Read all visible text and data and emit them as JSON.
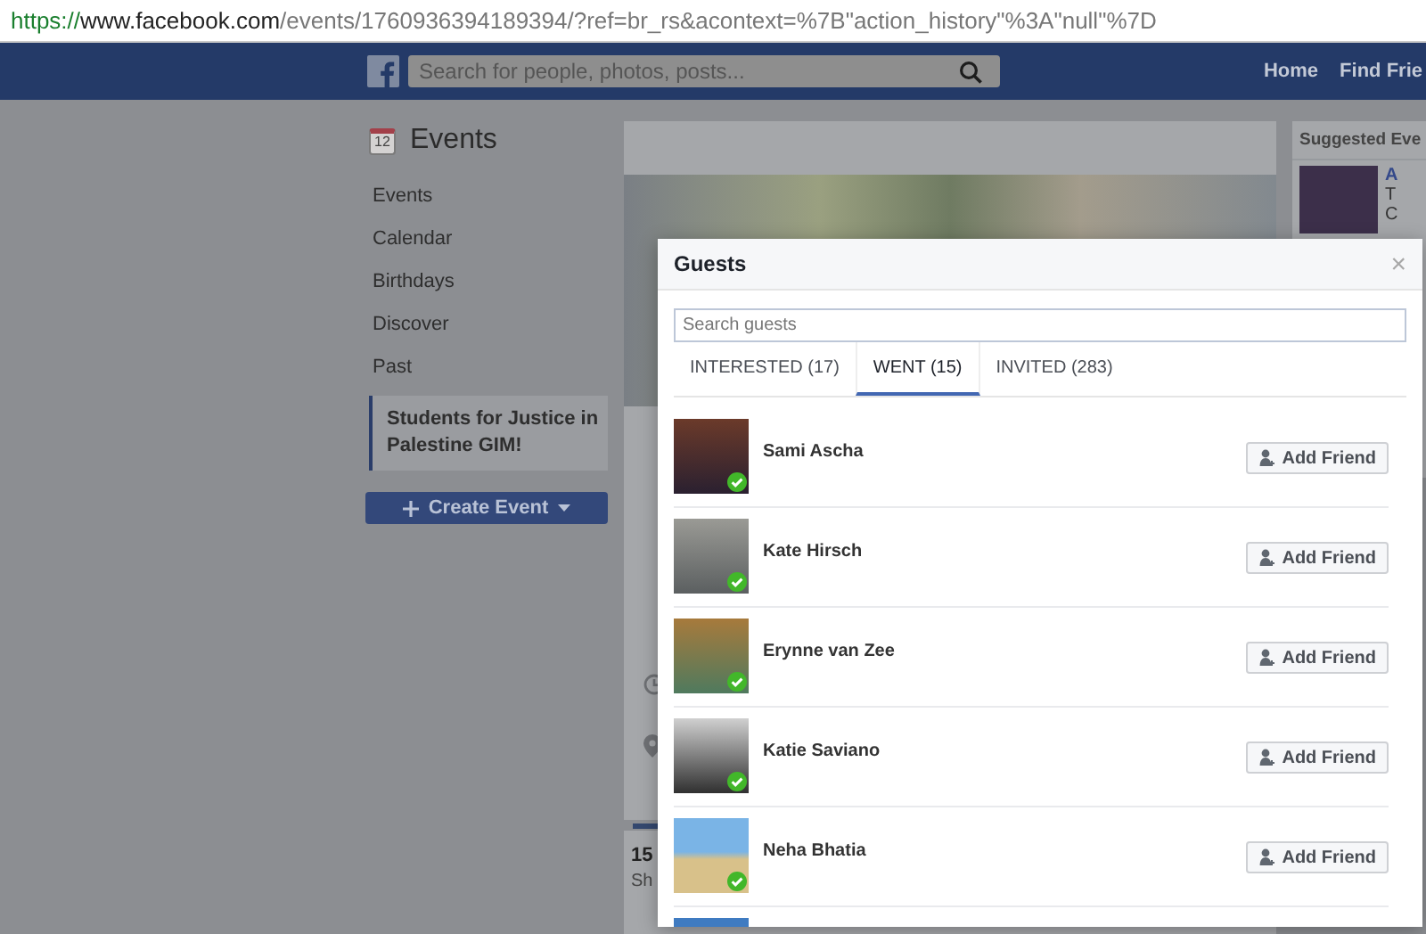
{
  "browser": {
    "scheme": "https://",
    "host": "www.facebook.com",
    "path": "/events/1760936394189394/?ref=br_rs&acontext=%7B\"action_history\"%3A\"null\"%7D"
  },
  "topbar": {
    "search": {
      "placeholder": "Search for people, photos, posts..."
    },
    "nav": [
      "Home",
      "Find Frie"
    ]
  },
  "sidebar": {
    "title": "Events",
    "calendar_day": "12",
    "items": [
      {
        "label": "Events",
        "selected": false
      },
      {
        "label": "Calendar",
        "selected": false
      },
      {
        "label": "Birthdays",
        "selected": false
      },
      {
        "label": "Discover",
        "selected": false
      },
      {
        "label": "Past",
        "selected": false
      },
      {
        "label": "Students for Justice in Palestine GIM!",
        "selected": true
      }
    ],
    "create_button": "Create Event"
  },
  "event": {
    "stat_value": "15",
    "stat_label": "Sh"
  },
  "suggested": {
    "heading": "Suggested Eve",
    "item": {
      "title": "A",
      "line_1": "T",
      "line_2": "C"
    }
  },
  "guests_dialog": {
    "title": "Guests",
    "close": "×",
    "search": {
      "placeholder": "Search guests"
    },
    "tabs": [
      {
        "label": "INTERESTED (17)",
        "selected": false
      },
      {
        "label": "WENT (15)",
        "selected": true
      },
      {
        "label": "INVITED (283)",
        "selected": false
      }
    ],
    "guests": [
      {
        "name": "Sami Ascha",
        "went": true,
        "action": "Add Friend"
      },
      {
        "name": "Kate Hirsch",
        "went": true,
        "action": "Add Friend"
      },
      {
        "name": "Erynne van Zee",
        "went": true,
        "action": "Add Friend"
      },
      {
        "name": "Katie Saviano",
        "went": true,
        "action": "Add Friend"
      },
      {
        "name": "Neha Bhatia",
        "went": true,
        "action": "Add Friend"
      }
    ]
  }
}
